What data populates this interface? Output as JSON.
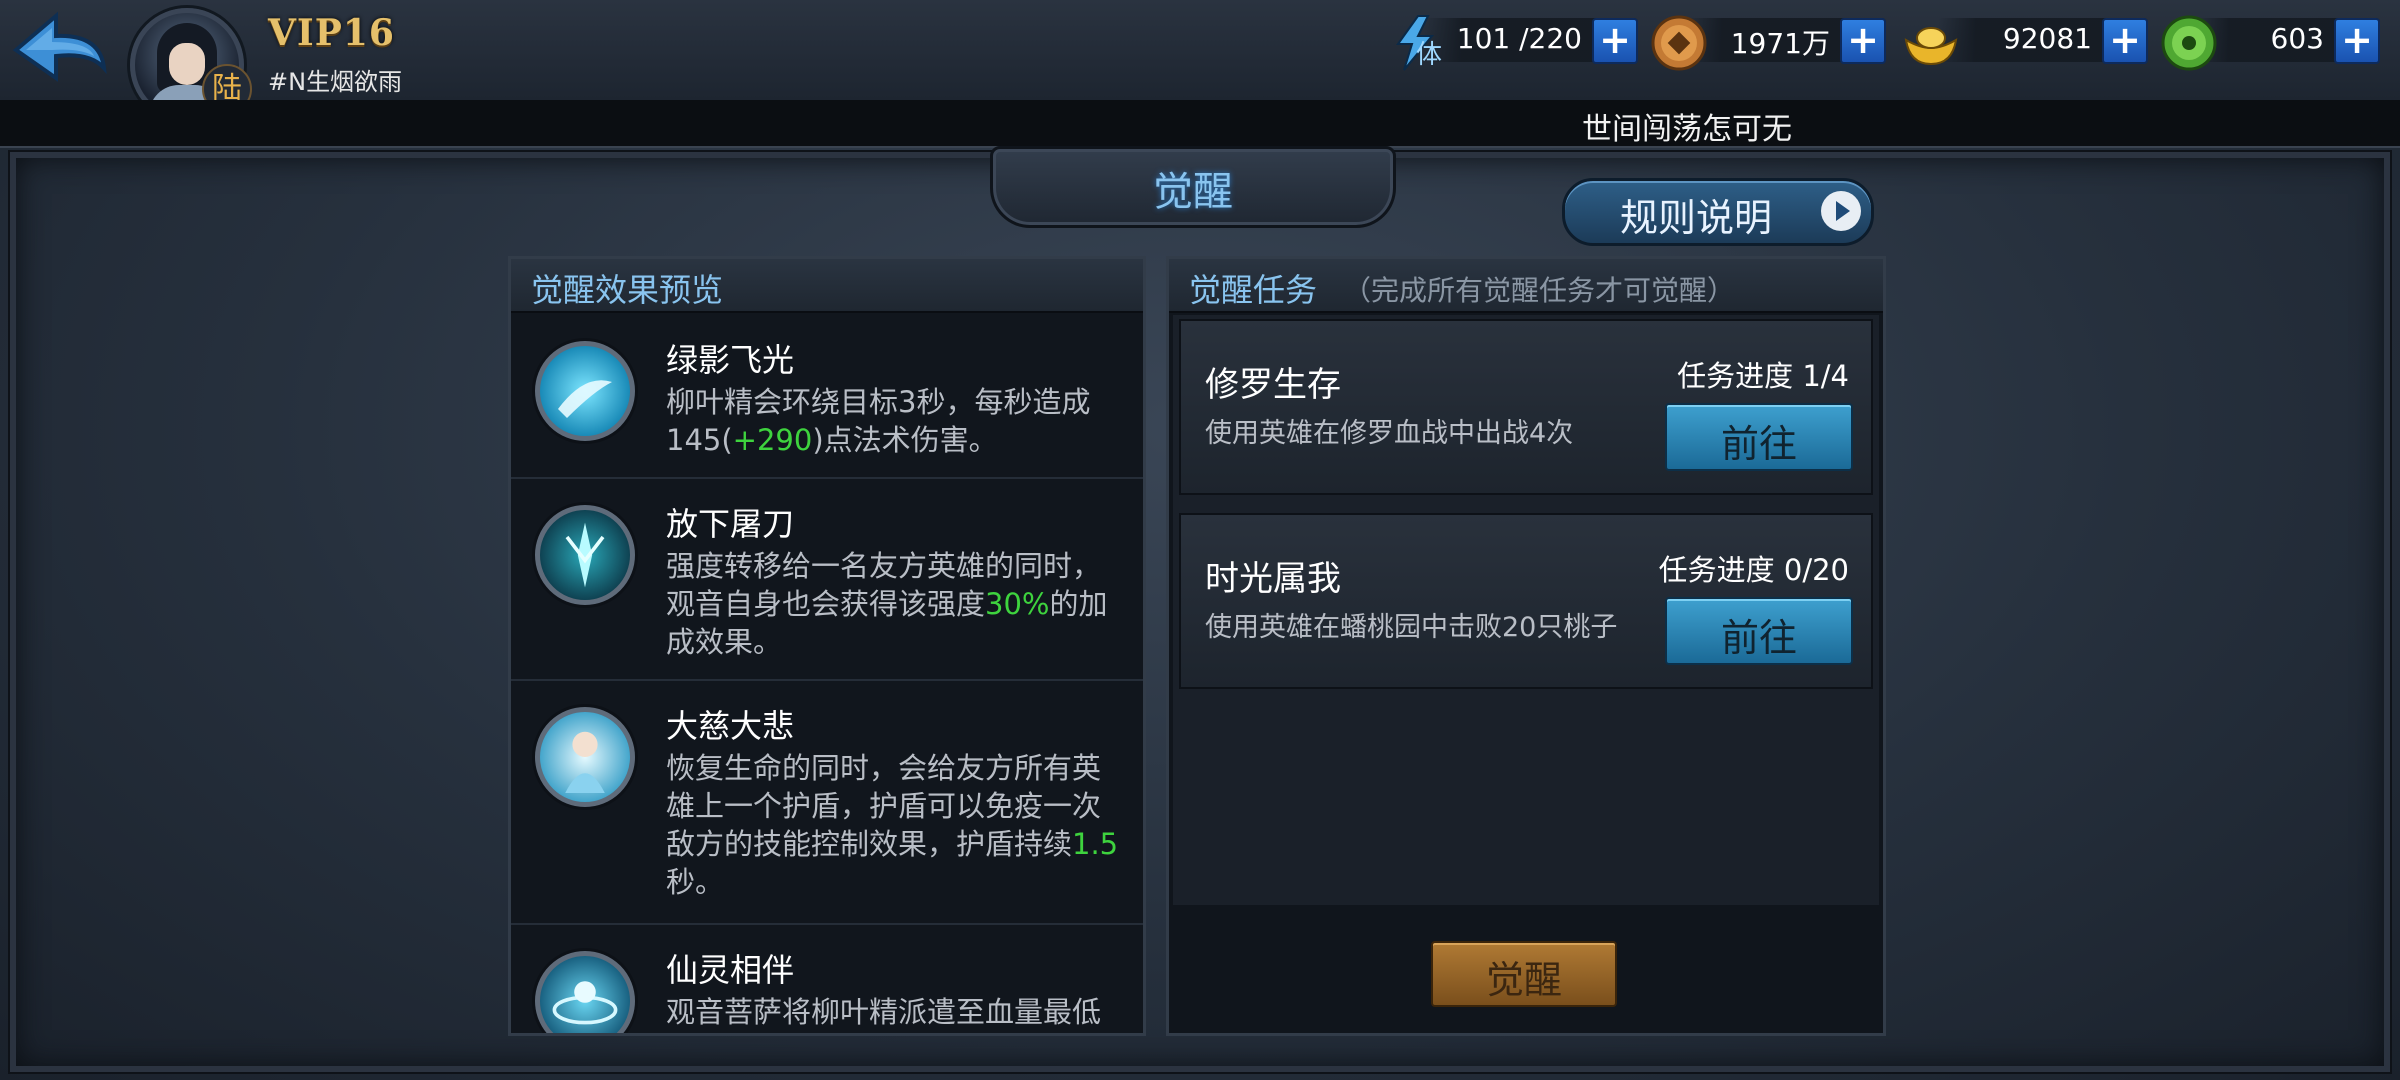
{
  "header": {
    "vip_label": "VIP16",
    "player_name": "#N生烟欲雨",
    "rank_badge": "陆",
    "stamina": {
      "icon": "lightning-stamina-icon",
      "badge": "体",
      "value": "101 /220"
    },
    "copper": {
      "icon": "copper-coin-icon",
      "value": "1971万"
    },
    "gold": {
      "icon": "gold-ingot-icon",
      "value": "92081"
    },
    "jade": {
      "icon": "jade-coin-icon",
      "value": "603"
    },
    "plus_label": "+"
  },
  "marquee": "世间闯荡怎可无",
  "title": "觉醒",
  "rules_button": "规则说明",
  "preview": {
    "header": "觉醒效果预览",
    "effects": [
      {
        "name": "绿影飞光",
        "desc_a": "柳叶精会环绕目标3秒，每秒造成145(",
        "highlight": "+290",
        "desc_b": ")点法术伤害。",
        "icon": "green-shadow-skill-icon"
      },
      {
        "name": "放下屠刀",
        "desc_a": "强度转移给一名友方英雄的同时，观音自身也会获得该强度",
        "highlight": "30%",
        "desc_b": "的加成效果。",
        "icon": "lay-down-blade-skill-icon"
      },
      {
        "name": "大慈大悲",
        "desc_a": "恢复生命的同时，会给友方所有英雄上一个护盾，护盾可以免疫一次敌方的技能控制效果，护盾持续",
        "highlight": "1.5",
        "desc_b": "秒。",
        "icon": "mercy-skill-icon"
      },
      {
        "name": "仙灵相伴",
        "desc_a": "观音菩萨将柳叶精派遣至血量最低",
        "highlight": "",
        "desc_b": "",
        "icon": "spirit-companion-skill-icon"
      }
    ]
  },
  "tasks": {
    "header": "觉醒任务",
    "subheader": "（完成所有觉醒任务才可觉醒）",
    "items": [
      {
        "name": "修罗生存",
        "desc": "使用英雄在修罗血战中出战4次",
        "progress": "任务进度 1/4",
        "button": "前往"
      },
      {
        "name": "时光属我",
        "desc": "使用英雄在蟠桃园中击败20只桃子",
        "progress": "任务进度 0/20",
        "button": "前往"
      }
    ],
    "awaken_button": "觉醒"
  },
  "colors": {
    "accent_blue": "#89c4ef",
    "highlight_green": "#3ed33e",
    "plus_blue": "#2f7fe0",
    "awaken_gold": "#b07a34"
  }
}
